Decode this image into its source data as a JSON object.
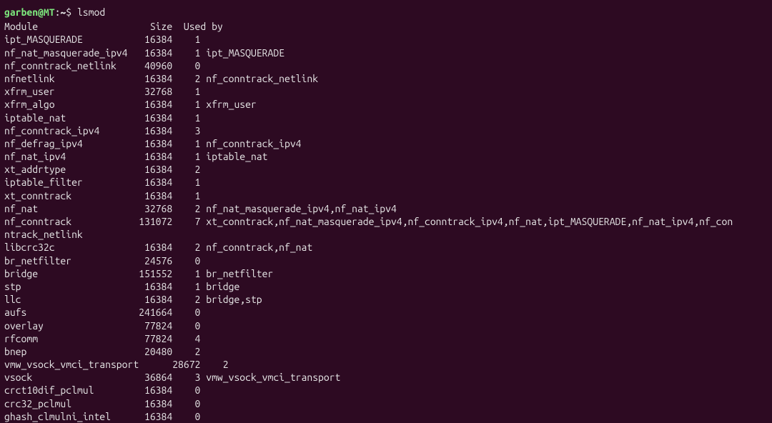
{
  "prompt": {
    "user": "garben",
    "host": "MT",
    "path": "~",
    "command": "lsmod"
  },
  "header": {
    "name": "Module",
    "size": "Size",
    "used_by": "Used by"
  },
  "modules": [
    {
      "name": "ipt_MASQUERADE",
      "size": "16384",
      "refs": "1",
      "used_by": ""
    },
    {
      "name": "nf_nat_masquerade_ipv4",
      "size": "16384",
      "refs": "1",
      "used_by": "ipt_MASQUERADE"
    },
    {
      "name": "nf_conntrack_netlink",
      "size": "40960",
      "refs": "0",
      "used_by": ""
    },
    {
      "name": "nfnetlink",
      "size": "16384",
      "refs": "2",
      "used_by": "nf_conntrack_netlink"
    },
    {
      "name": "xfrm_user",
      "size": "32768",
      "refs": "1",
      "used_by": ""
    },
    {
      "name": "xfrm_algo",
      "size": "16384",
      "refs": "1",
      "used_by": "xfrm_user"
    },
    {
      "name": "iptable_nat",
      "size": "16384",
      "refs": "1",
      "used_by": ""
    },
    {
      "name": "nf_conntrack_ipv4",
      "size": "16384",
      "refs": "3",
      "used_by": ""
    },
    {
      "name": "nf_defrag_ipv4",
      "size": "16384",
      "refs": "1",
      "used_by": "nf_conntrack_ipv4"
    },
    {
      "name": "nf_nat_ipv4",
      "size": "16384",
      "refs": "1",
      "used_by": "iptable_nat"
    },
    {
      "name": "xt_addrtype",
      "size": "16384",
      "refs": "2",
      "used_by": ""
    },
    {
      "name": "iptable_filter",
      "size": "16384",
      "refs": "1",
      "used_by": ""
    },
    {
      "name": "xt_conntrack",
      "size": "16384",
      "refs": "1",
      "used_by": ""
    },
    {
      "name": "nf_nat",
      "size": "32768",
      "refs": "2",
      "used_by": "nf_nat_masquerade_ipv4,nf_nat_ipv4"
    },
    {
      "name": "nf_conntrack",
      "size": "131072",
      "refs": "7",
      "used_by": "xt_conntrack,nf_nat_masquerade_ipv4,nf_conntrack_ipv4,nf_nat,ipt_MASQUERADE,nf_nat_ipv4,nf_conntrack_netlink"
    },
    {
      "name": "libcrc32c",
      "size": "16384",
      "refs": "2",
      "used_by": "nf_conntrack,nf_nat"
    },
    {
      "name": "br_netfilter",
      "size": "24576",
      "refs": "0",
      "used_by": ""
    },
    {
      "name": "bridge",
      "size": "151552",
      "refs": "1",
      "used_by": "br_netfilter"
    },
    {
      "name": "stp",
      "size": "16384",
      "refs": "1",
      "used_by": "bridge"
    },
    {
      "name": "llc",
      "size": "16384",
      "refs": "2",
      "used_by": "bridge,stp"
    },
    {
      "name": "aufs",
      "size": "241664",
      "refs": "0",
      "used_by": ""
    },
    {
      "name": "overlay",
      "size": "77824",
      "refs": "0",
      "used_by": ""
    },
    {
      "name": "rfcomm",
      "size": "77824",
      "refs": "4",
      "used_by": ""
    },
    {
      "name": "bnep",
      "size": "20480",
      "refs": "2",
      "used_by": ""
    },
    {
      "name": "vmw_vsock_vmci_transport",
      "size": "28672",
      "refs": "2",
      "used_by": ""
    },
    {
      "name": "vsock",
      "size": "36864",
      "refs": "3",
      "used_by": "vmw_vsock_vmci_transport"
    },
    {
      "name": "crct10dif_pclmul",
      "size": "16384",
      "refs": "0",
      "used_by": ""
    },
    {
      "name": "crc32_pclmul",
      "size": "16384",
      "refs": "0",
      "used_by": ""
    },
    {
      "name": "ghash_clmulni_intel",
      "size": "16384",
      "refs": "0",
      "used_by": ""
    }
  ],
  "wrapped_line": "ntrack_netlink",
  "layout": {
    "name_col_width": 23,
    "size_col_width": 7,
    "refs_col_width": 3
  }
}
